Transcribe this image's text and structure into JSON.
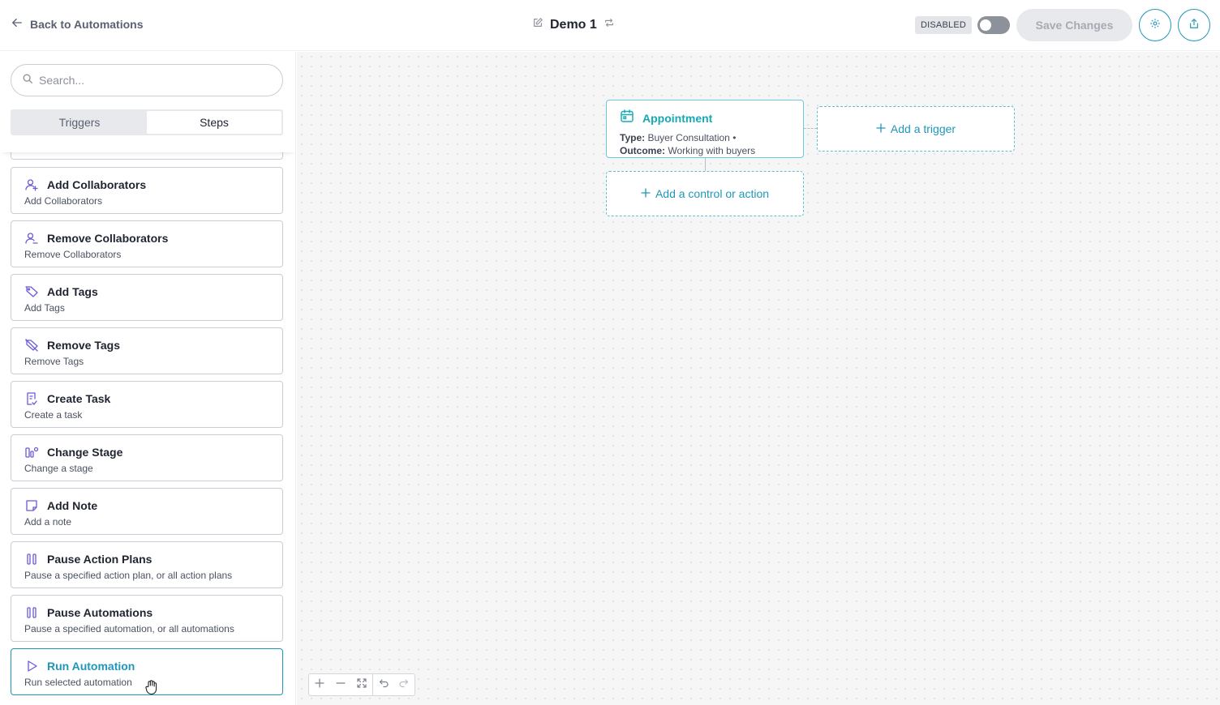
{
  "header": {
    "back_label": "Back to Automations",
    "title": "Demo 1",
    "status_badge": "DISABLED",
    "save_label": "Save Changes"
  },
  "sidebar": {
    "search_placeholder": "Search...",
    "tabs": [
      {
        "label": "Triggers",
        "active": false
      },
      {
        "label": "Steps",
        "active": true
      }
    ],
    "steps": [
      {
        "title": "Add Collaborators",
        "desc": "Add Collaborators",
        "icon": "user-plus-icon"
      },
      {
        "title": "Remove Collaborators",
        "desc": "Remove Collaborators",
        "icon": "user-minus-icon"
      },
      {
        "title": "Add Tags",
        "desc": "Add Tags",
        "icon": "tag-icon"
      },
      {
        "title": "Remove Tags",
        "desc": "Remove Tags",
        "icon": "tag-off-icon"
      },
      {
        "title": "Create Task",
        "desc": "Create a task",
        "icon": "task-icon"
      },
      {
        "title": "Change Stage",
        "desc": "Change a stage",
        "icon": "stage-icon"
      },
      {
        "title": "Add Note",
        "desc": "Add a note",
        "icon": "note-icon"
      },
      {
        "title": "Pause Action Plans",
        "desc": "Pause a specified action plan, or all action plans",
        "icon": "pause-icon"
      },
      {
        "title": "Pause Automations",
        "desc": "Pause a specified automation, or all automations",
        "icon": "pause-icon"
      },
      {
        "title": "Run Automation",
        "desc": "Run selected automation",
        "icon": "play-icon"
      }
    ]
  },
  "canvas": {
    "trigger_node": {
      "title": "Appointment",
      "type_label": "Type:",
      "type_value": "Buyer Consultation •",
      "outcome_label": "Outcome:",
      "outcome_value": "Working with buyers"
    },
    "add_trigger_label": "Add a trigger",
    "add_action_label": "Add a control or action"
  },
  "colors": {
    "accent": "#1f97b8",
    "trigger_title": "#17a9b4",
    "step_icon": "#6b5bd6"
  }
}
